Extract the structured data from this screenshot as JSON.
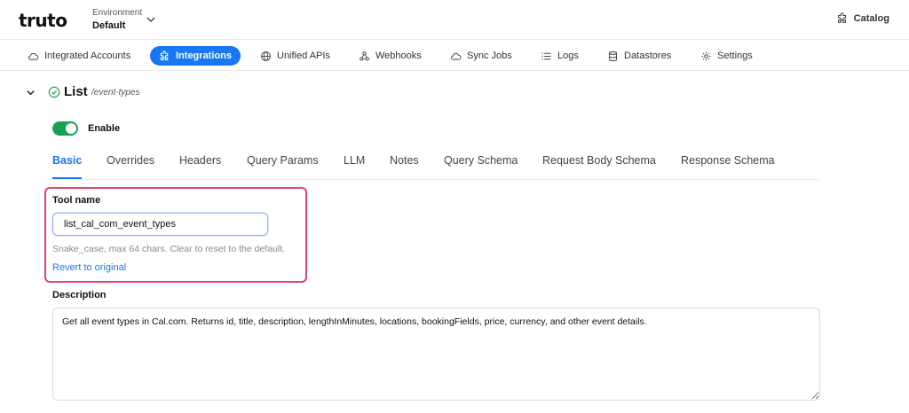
{
  "app": {
    "logo": "truto"
  },
  "environment": {
    "label": "Environment",
    "value": "Default"
  },
  "catalog": {
    "label": "Catalog"
  },
  "nav": {
    "items": [
      {
        "label": "Integrated Accounts",
        "icon": "cloud-icon"
      },
      {
        "label": "Integrations",
        "icon": "puzzle-icon",
        "active": true
      },
      {
        "label": "Unified APIs",
        "icon": "globe-icon"
      },
      {
        "label": "Webhooks",
        "icon": "webhook-icon"
      },
      {
        "label": "Sync Jobs",
        "icon": "cloud-sync-icon"
      },
      {
        "label": "Logs",
        "icon": "list-icon"
      },
      {
        "label": "Datastores",
        "icon": "database-icon"
      },
      {
        "label": "Settings",
        "icon": "gear-icon"
      }
    ]
  },
  "section": {
    "title": "List",
    "path": "/event-types"
  },
  "toggle": {
    "label": "Enable",
    "on": true
  },
  "tabs": [
    "Basic",
    "Overrides",
    "Headers",
    "Query Params",
    "LLM",
    "Notes",
    "Query Schema",
    "Request Body Schema",
    "Response Schema"
  ],
  "tool": {
    "label": "Tool name",
    "value": "list_cal_com_event_types",
    "hint": "Snake_case, max 64 chars. Clear to reset to the default.",
    "revert": "Revert to original"
  },
  "description": {
    "label": "Description",
    "value": "Get all event types in Cal.com. Returns id, title, description, lengthInMinutes, locations, bookingFields, price, currency, and other event details."
  },
  "colors": {
    "accent": "#1877f2",
    "toggle": "#1aa053",
    "highlight": "#e0446a"
  }
}
